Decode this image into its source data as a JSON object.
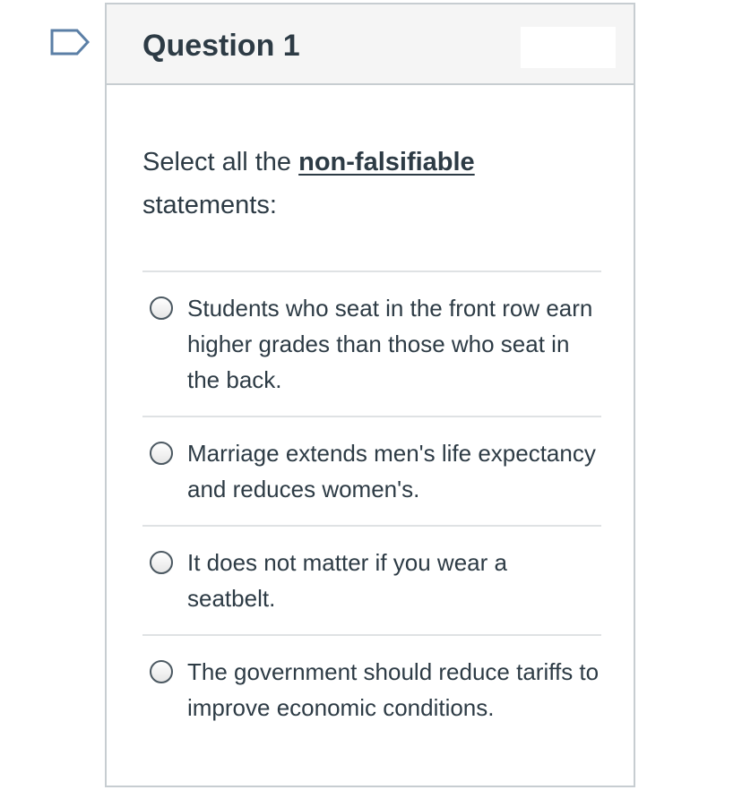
{
  "question": {
    "title": "Question 1",
    "prompt_prefix": "Select all the ",
    "prompt_emphasis": "non-falsifiable",
    "prompt_suffix": "statements:"
  },
  "answers": [
    {
      "text": "Students who seat in the front row earn higher grades than those who seat in the back."
    },
    {
      "text": "Marriage extends men's life expectancy and reduces women's."
    },
    {
      "text": "It does not matter if you wear a seatbelt."
    },
    {
      "text": "The government should reduce tariffs to improve economic conditions."
    }
  ],
  "colors": {
    "text": "#2d3b45",
    "border": "#c7cdd1",
    "header_bg": "#f5f5f5",
    "flag": "#5b7fa6"
  },
  "icons": {
    "flag": "flag-bookmark-icon"
  }
}
